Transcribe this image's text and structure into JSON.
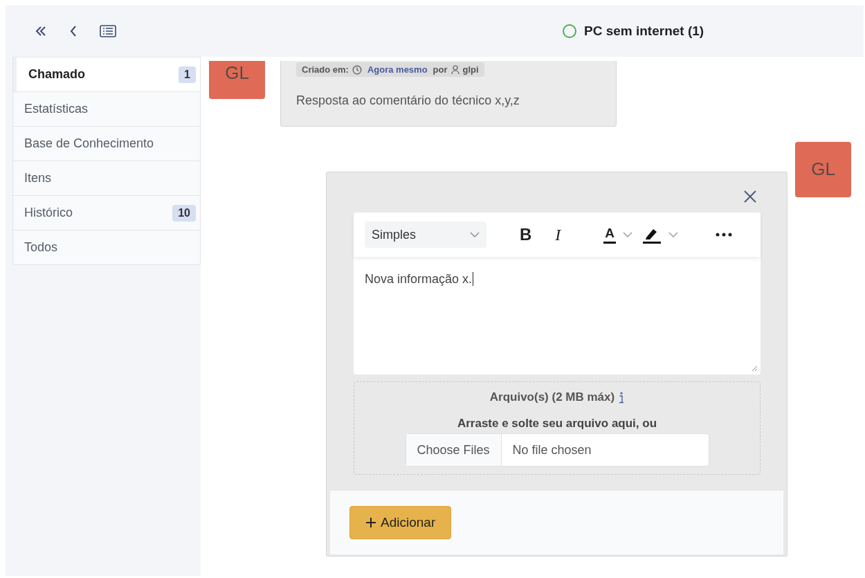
{
  "header": {
    "title": "PC sem internet (1)"
  },
  "sidebar": {
    "items": [
      {
        "label": "Chamado",
        "badge": "1",
        "selected": true
      },
      {
        "label": "Estatísticas",
        "selected": false
      },
      {
        "label": "Base de Conhecimento",
        "selected": false
      },
      {
        "label": "Itens",
        "selected": false
      },
      {
        "label": "Histórico",
        "badge": "10",
        "selected": false
      },
      {
        "label": "Todos",
        "selected": false
      }
    ]
  },
  "timeline": {
    "comment": {
      "avatar": "GL",
      "created_label": "Criado em:",
      "time": "Agora mesmo",
      "by": "por",
      "author": "glpi",
      "text": "Resposta ao comentário do técnico x,y,z"
    },
    "form": {
      "avatar": "GL",
      "editor": {
        "format": "Simples",
        "bold": "B",
        "italic": "I",
        "text_color": "A",
        "value": "Nova informação x."
      },
      "attachments": {
        "title": "Arquivo(s) (2 MB máx)",
        "hint": "Arraste e solte seu arquivo aqui, ou",
        "choose_button": "Choose Files",
        "file_status": "No file chosen"
      },
      "submit": "Adicionar"
    }
  }
}
